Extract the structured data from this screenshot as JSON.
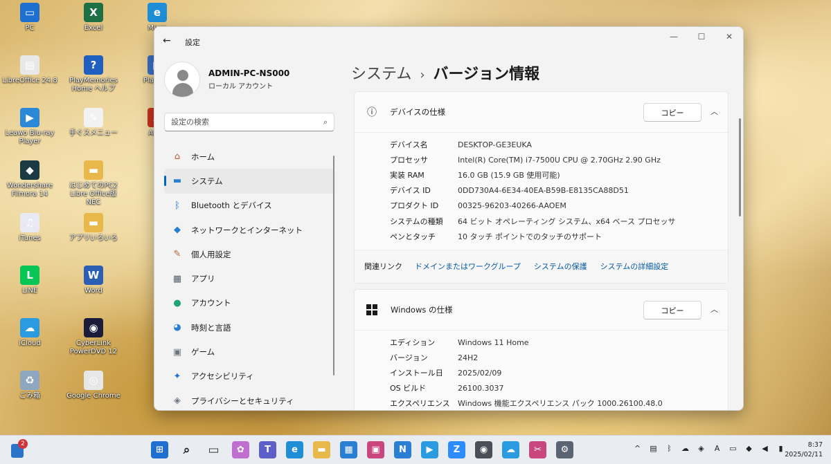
{
  "desktop": {
    "icons": [
      {
        "label": "PC",
        "icon": "pc-icon",
        "color": "#1f6fd1",
        "glyph": "▭"
      },
      {
        "label": "Excel",
        "icon": "excel-icon",
        "color": "#1d7044",
        "glyph": "X"
      },
      {
        "label": "Micro",
        "icon": "edge-icon",
        "color": "#1f8ed6",
        "glyph": "e"
      },
      {
        "label": "LibreOffice 24.8",
        "icon": "libreoffice-icon",
        "color": "#e8e8e8",
        "glyph": "▤"
      },
      {
        "label": "PlayMemories Home ヘルプ",
        "icon": "help-icon",
        "color": "#1e5fbf",
        "glyph": "?"
      },
      {
        "label": "PlayM H",
        "icon": "playmemories-icon",
        "color": "#3a6fc7",
        "glyph": "▶"
      },
      {
        "label": "Leawo Blu-ray Player",
        "icon": "leawo-icon",
        "color": "#2a88d6",
        "glyph": "▶"
      },
      {
        "label": "手ぐスメニュー",
        "icon": "menu-app-icon",
        "color": "#f2f2f2",
        "glyph": "✎"
      },
      {
        "label": "Adob",
        "icon": "adobe-icon",
        "color": "#c8321e",
        "glyph": "A"
      },
      {
        "label": "Wondershare Filmora 14",
        "icon": "filmora-icon",
        "color": "#1b3a44",
        "glyph": "◆"
      },
      {
        "label": "はじめてのPC2 Libre Office版 NEC",
        "icon": "folder-icon",
        "color": "#e8b84a",
        "glyph": "▬"
      },
      {
        "label": "iTunes",
        "icon": "itunes-icon",
        "color": "#e9e9f4",
        "glyph": "♫"
      },
      {
        "label": "アプリいろいろ",
        "icon": "folder-icon",
        "color": "#e8b84a",
        "glyph": "▬"
      },
      {
        "label": "LINE",
        "icon": "line-icon",
        "color": "#06c755",
        "glyph": "L"
      },
      {
        "label": "Word",
        "icon": "word-icon",
        "color": "#2b5fb4",
        "glyph": "W"
      },
      {
        "label": "iCloud",
        "icon": "icloud-icon",
        "color": "#2a9be0",
        "glyph": "☁"
      },
      {
        "label": "CyberLink PowerDVD 12",
        "icon": "powerdvd-icon",
        "color": "#1c1c3a",
        "glyph": "◉"
      },
      {
        "label": "ごみ箱",
        "icon": "recycle-bin-icon",
        "color": "#8fa6c0",
        "glyph": "♻"
      },
      {
        "label": "Google Chrome",
        "icon": "chrome-icon",
        "color": "#e7e7e7",
        "glyph": "◎"
      }
    ]
  },
  "window": {
    "title": "設定",
    "profile": {
      "name": "ADMIN-PC-NS000",
      "type": "ローカル アカウント"
    },
    "search_placeholder": "設定の検索",
    "nav": [
      {
        "label": "ホーム",
        "icon": "home-icon",
        "glyph": "⌂",
        "color": "#c45a2a"
      },
      {
        "label": "システム",
        "icon": "system-icon",
        "glyph": "▬",
        "color": "#2a7fd4"
      },
      {
        "label": "Bluetooth とデバイス",
        "icon": "bluetooth-icon",
        "glyph": "ᛒ",
        "color": "#1f6fd1"
      },
      {
        "label": "ネットワークとインターネット",
        "icon": "wifi-icon",
        "glyph": "◆",
        "color": "#2a7fd4"
      },
      {
        "label": "個人用設定",
        "icon": "brush-icon",
        "glyph": "✎",
        "color": "#b5653a"
      },
      {
        "label": "アプリ",
        "icon": "apps-icon",
        "glyph": "▦",
        "color": "#556070"
      },
      {
        "label": "アカウント",
        "icon": "account-icon",
        "glyph": "●",
        "color": "#1fa37a"
      },
      {
        "label": "時刻と言語",
        "icon": "globe-icon",
        "glyph": "◕",
        "color": "#2a7fd4"
      },
      {
        "label": "ゲーム",
        "icon": "gamepad-icon",
        "glyph": "▣",
        "color": "#6e7682"
      },
      {
        "label": "アクセシビリティ",
        "icon": "accessibility-icon",
        "glyph": "✦",
        "color": "#1f6fd1"
      },
      {
        "label": "プライバシーとセキュリティ",
        "icon": "shield-icon",
        "glyph": "◈",
        "color": "#6e7682"
      }
    ],
    "breadcrumb": {
      "parent": "システム",
      "separator": "›",
      "current": "バージョン情報"
    },
    "device_card": {
      "title": "デバイスの仕様",
      "copy_label": "コピー",
      "specs": [
        {
          "key": "デバイス名",
          "value": "DESKTOP-GE3EUKA"
        },
        {
          "key": "プロセッサ",
          "value": "Intel(R) Core(TM) i7-7500U CPU @ 2.70GHz   2.90 GHz"
        },
        {
          "key": "実装 RAM",
          "value": "16.0 GB (15.9 GB 使用可能)"
        },
        {
          "key": "デバイス ID",
          "value": "0DD730A4-6E34-40EA-B59B-E8135CA88D51"
        },
        {
          "key": "プロダクト ID",
          "value": "00325-96203-40266-AAOEM"
        },
        {
          "key": "システムの種類",
          "value": "64 ビット オペレーティング システム、x64 ベース プロセッサ"
        },
        {
          "key": "ペンとタッチ",
          "value": "10 タッチ ポイントでのタッチのサポート"
        }
      ],
      "related_label": "関連リンク",
      "related_links": [
        "ドメインまたはワークグループ",
        "システムの保護",
        "システムの詳細設定"
      ]
    },
    "windows_card": {
      "title": "Windows の仕様",
      "copy_label": "コピー",
      "specs": [
        {
          "key": "エディション",
          "value": "Windows 11 Home"
        },
        {
          "key": "バージョン",
          "value": "24H2"
        },
        {
          "key": "インストール日",
          "value": "2025/02/09"
        },
        {
          "key": "OS ビルド",
          "value": "26100.3037"
        },
        {
          "key": "エクスペリエンス",
          "value": "Windows 機能エクスペリエンス パック 1000.26100.48.0"
        }
      ]
    }
  },
  "taskbar": {
    "widget_badge": "2",
    "apps": [
      {
        "icon": "start-icon",
        "glyph": "⊞",
        "color": "#1f6fd1"
      },
      {
        "icon": "search-icon",
        "glyph": "⌕",
        "color": "#222222"
      },
      {
        "icon": "task-view-icon",
        "glyph": "▭",
        "color": "#333333"
      },
      {
        "icon": "copilot-icon",
        "glyph": "✿",
        "color": "#c06fd0"
      },
      {
        "icon": "teams-icon",
        "glyph": "T",
        "color": "#5b5fc7"
      },
      {
        "icon": "edge-icon",
        "glyph": "e",
        "color": "#1f8ed6"
      },
      {
        "icon": "file-explorer-icon",
        "glyph": "▬",
        "color": "#e8b84a"
      },
      {
        "icon": "store-icon",
        "glyph": "▦",
        "color": "#2a7fd4"
      },
      {
        "icon": "photos-icon",
        "glyph": "▣",
        "color": "#c9467e"
      },
      {
        "icon": "news-icon",
        "glyph": "N",
        "color": "#2a7fd4"
      },
      {
        "icon": "media-player-icon",
        "glyph": "▶",
        "color": "#2a9be0"
      },
      {
        "icon": "zoom-icon",
        "glyph": "Z",
        "color": "#2d8cff"
      },
      {
        "icon": "camera-icon",
        "glyph": "◉",
        "color": "#4a4f58"
      },
      {
        "icon": "icloud-icon",
        "glyph": "☁",
        "color": "#2a9be0"
      },
      {
        "icon": "snipping-tool-icon",
        "glyph": "✂",
        "color": "#c9467e"
      },
      {
        "icon": "settings-icon",
        "glyph": "⚙",
        "color": "#5a6472"
      }
    ],
    "tray_icons": [
      "chevron-up-icon",
      "network-monitor-icon",
      "bluetooth-icon",
      "onedrive-icon",
      "security-icon",
      "ime-icon",
      "language-icon",
      "wifi-icon",
      "volume-icon",
      "battery-icon"
    ],
    "tray_glyphs": [
      "^",
      "▤",
      "ᛒ",
      "☁",
      "◈",
      "A",
      "▭",
      "◆",
      "◀",
      "▮"
    ],
    "time": "8:37",
    "date": "2025/02/11"
  }
}
